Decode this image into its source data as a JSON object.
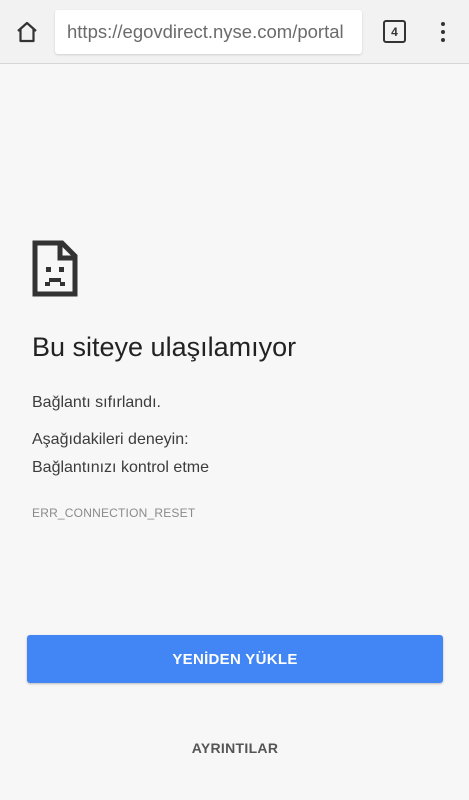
{
  "toolbar": {
    "url": "https://egovdirect.nyse.com/portal",
    "tab_count": "4"
  },
  "error": {
    "title": "Bu siteye ulaşılamıyor",
    "reason": "Bağlantı sıfırlandı.",
    "try_heading": "Aşağıdakileri deneyin:",
    "suggestion": "Bağlantınızı kontrol etme",
    "code": "ERR_CONNECTION_RESET"
  },
  "actions": {
    "reload_label": "YENİDEN YÜKLE",
    "details_label": "AYRINTILAR"
  },
  "colors": {
    "accent": "#4285f4",
    "background": "#f7f7f7"
  }
}
